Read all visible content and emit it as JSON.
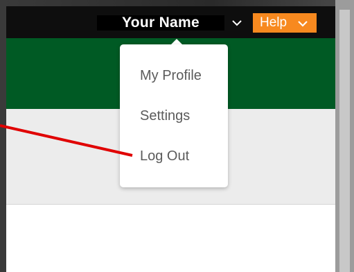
{
  "header": {
    "user_name": "Your Name",
    "help_label": "Help"
  },
  "dropdown": {
    "items": [
      {
        "label": "My Profile"
      },
      {
        "label": "Settings"
      },
      {
        "label": "Log Out"
      }
    ]
  },
  "colors": {
    "topbar": "#0e0e0e",
    "brand_green": "#005a24",
    "help_orange": "#f7891f",
    "annotation_red": "#e00000"
  },
  "icons": {
    "user_menu_chevron": "chevron-down-icon",
    "help_chevron": "chevron-down-icon"
  }
}
